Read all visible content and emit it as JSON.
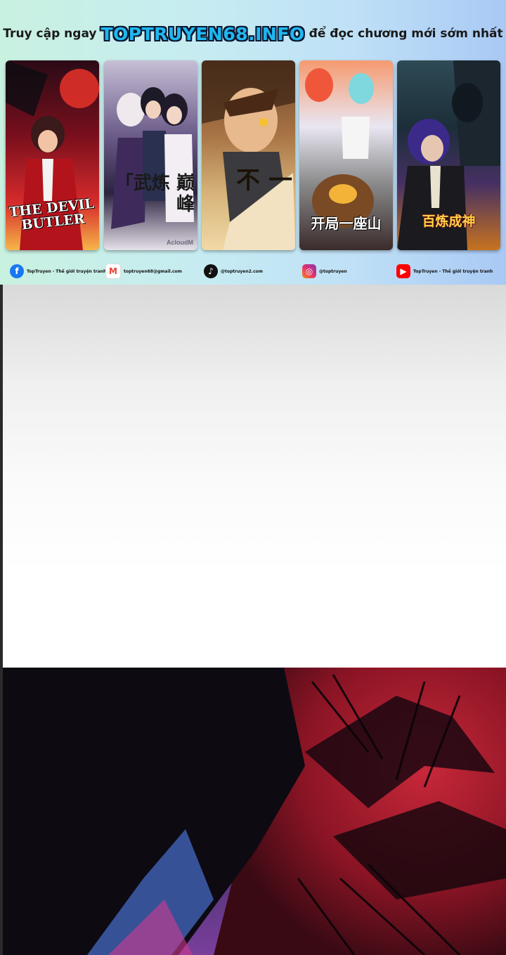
{
  "banner": {
    "prefix": "Truy cập ngay",
    "brand": "TOPTRUYEN68.INFO",
    "suffix": "để đọc chương mới sớm nhất",
    "brand_color": "#1fb7f0",
    "covers": [
      {
        "title": "THE DEVIL BUTLER"
      },
      {
        "title": "「武炼 巅峰",
        "watermark": "AcloudM"
      },
      {
        "title": "不 一"
      },
      {
        "title": "开局一座山"
      },
      {
        "title": "百炼成神"
      }
    ],
    "socials": [
      {
        "icon": "facebook-icon",
        "label": "TopTruyen - Thế giới truyện tranh"
      },
      {
        "icon": "gmail-icon",
        "label": "toptruyen68@gmail.com"
      },
      {
        "icon": "tiktok-icon",
        "label": "@toptruyen2.com"
      },
      {
        "icon": "instagram-icon",
        "label": "@toptruyen"
      },
      {
        "icon": "youtube-icon",
        "label": "TopTruyen - Thế giới truyện tranh"
      }
    ]
  }
}
